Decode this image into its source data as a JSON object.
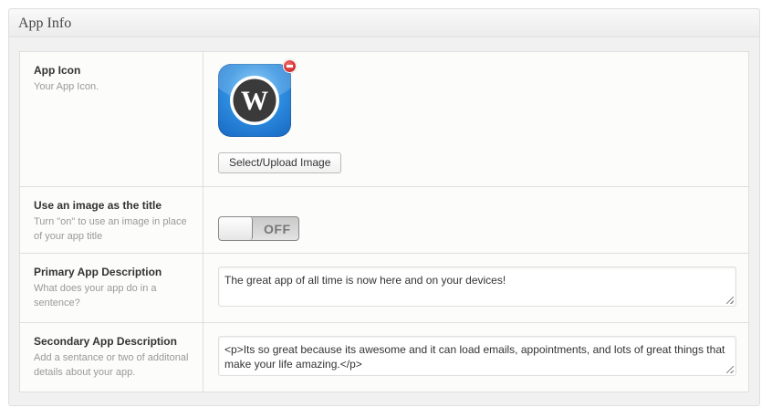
{
  "panel": {
    "title": "App Info"
  },
  "rows": [
    {
      "label": "App Icon",
      "description": "Your App Icon.",
      "icon": "wordpress-logo-icon",
      "button_label": "Select/Upload Image"
    },
    {
      "label": "Use an image as the title",
      "description": "Turn \"on\" to use an image in place of your app title",
      "toggle_state": "OFF"
    },
    {
      "label": "Primary App Description",
      "description": "What does your app do in a sentence?",
      "value": "The great app of all time is now here and on your devices!"
    },
    {
      "label": "Secondary App Description",
      "description": "Add a sentance or two of additonal details about your app.",
      "value": "<p>Its so great because its awesome and it can load emails, appointments, and lots of great things that make your life amazing.</p>"
    }
  ],
  "colors": {
    "remove": "#c21515",
    "icon_blue": "#2e8ee0"
  }
}
